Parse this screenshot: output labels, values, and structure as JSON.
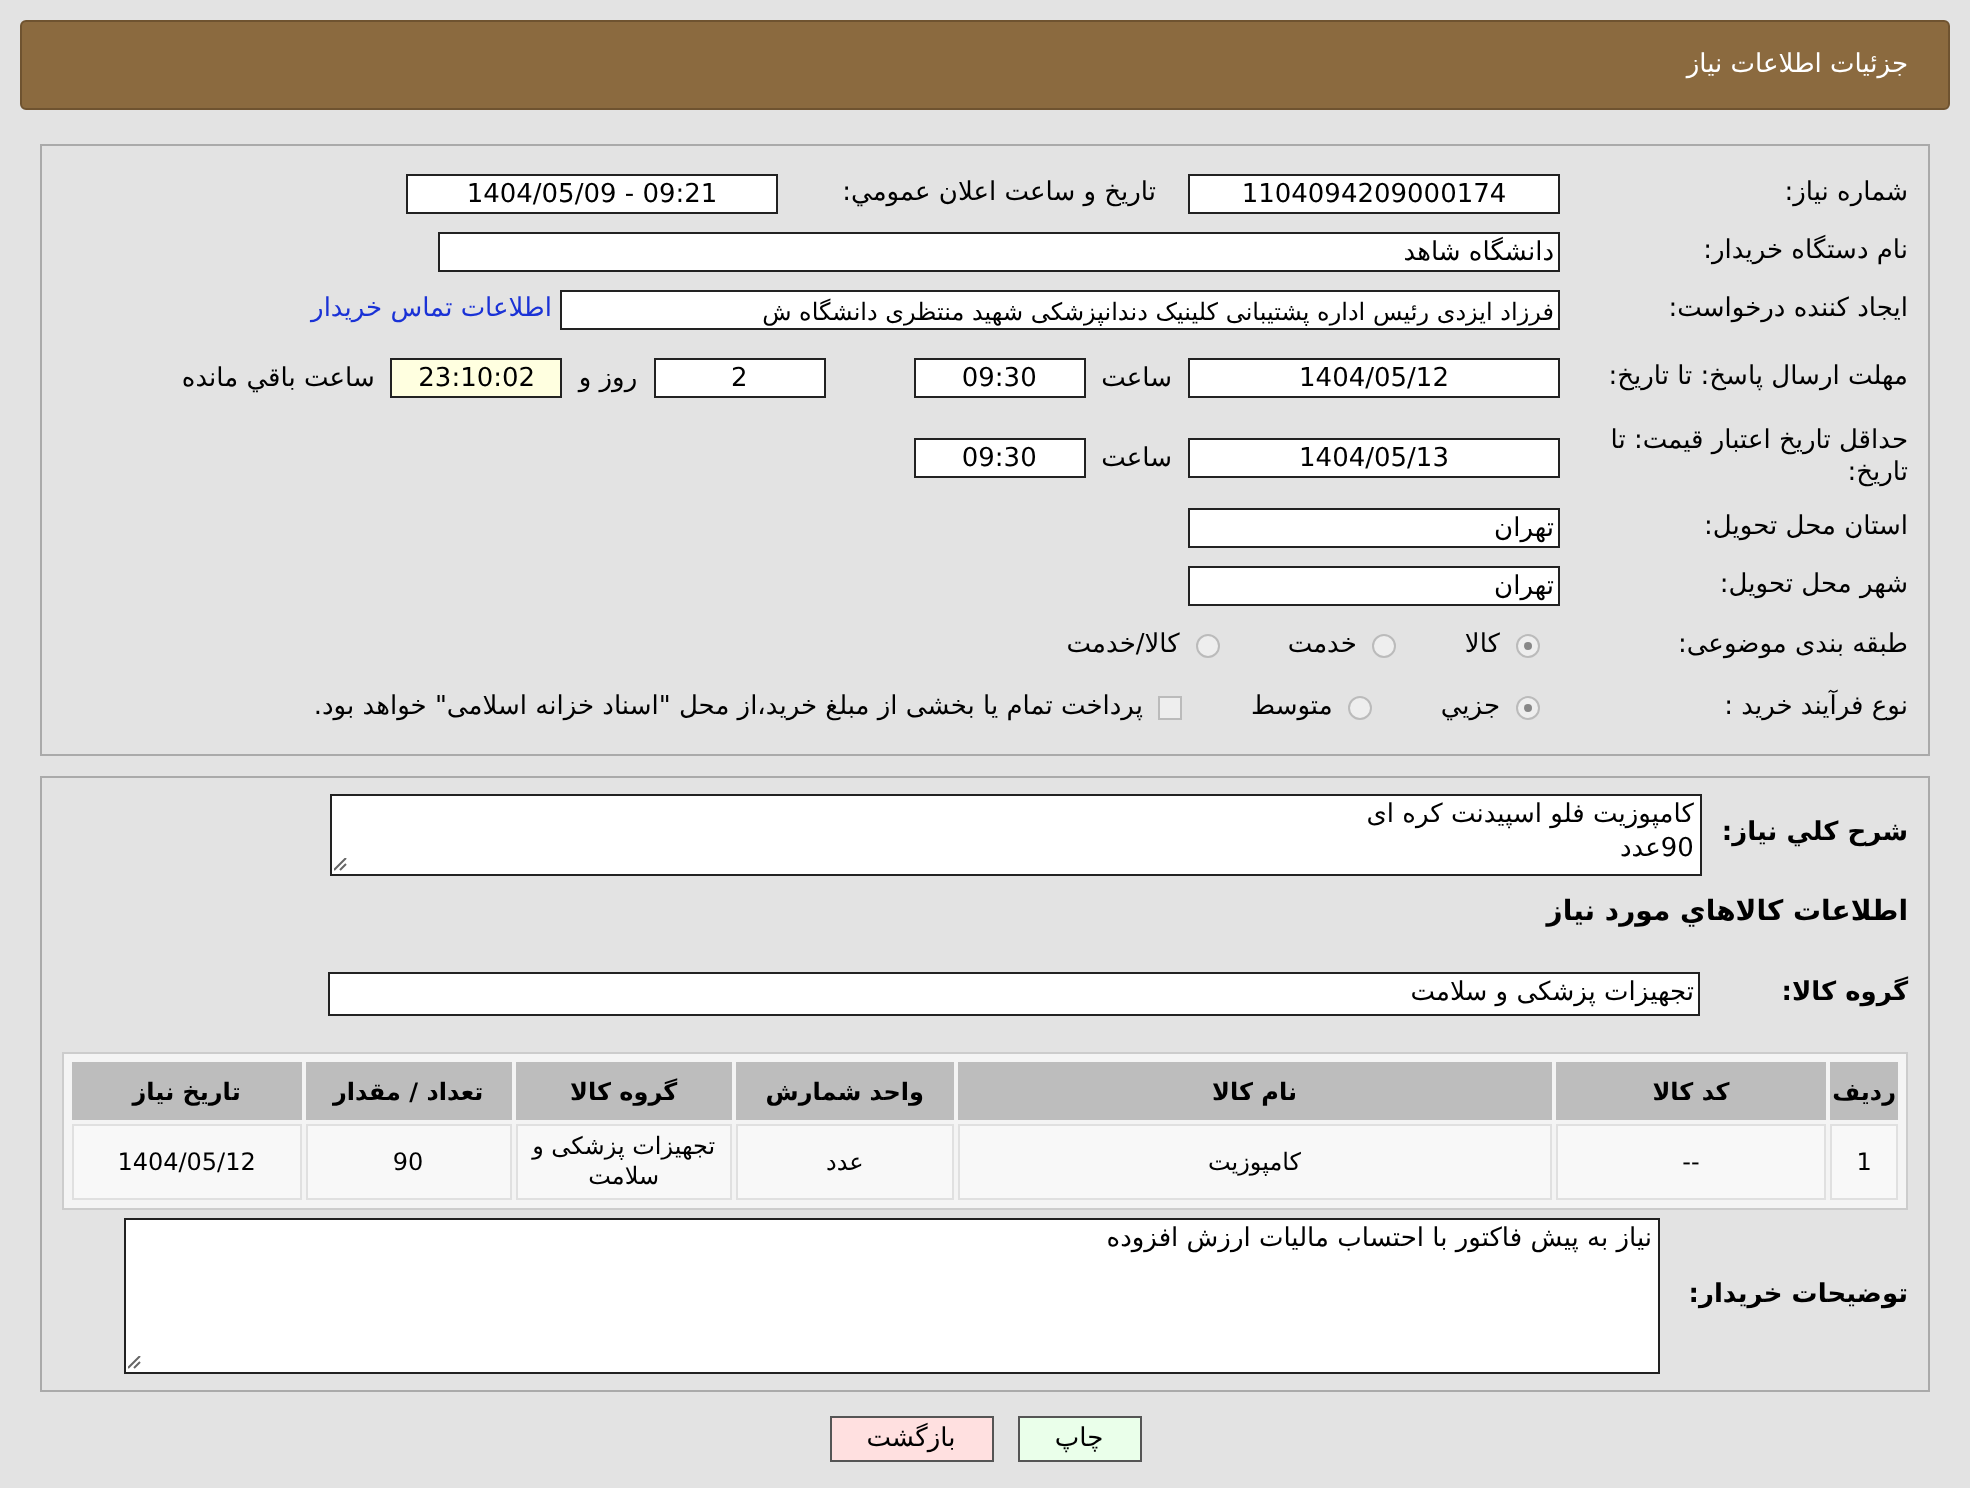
{
  "header": {
    "title": "جزئیات اطلاعات نیاز"
  },
  "need_number": {
    "label": "شماره نیاز:",
    "value": "1104094209000174"
  },
  "announce": {
    "label": "تاریخ و ساعت اعلان عمومي:",
    "value": "1404/05/09 - 09:21"
  },
  "buyer_org": {
    "label": "نام دستگاه خریدار:",
    "value": "دانشگاه شاهد"
  },
  "requester": {
    "label": "ایجاد کننده درخواست:",
    "value": "فرزاد ایزدی رئیس اداره پشتیبانی کلینیک دندانپزشکی شهید منتظری دانشگاه ش",
    "link": "اطلاعات تماس خریدار"
  },
  "reply_deadline": {
    "label": "مهلت ارسال پاسخ: تا تاریخ:",
    "date": "1404/05/12",
    "time_label": "ساعت",
    "time": "09:30",
    "days": "2",
    "days_label": "روز و",
    "remaining": "23:10:02",
    "remaining_label": "ساعت باقي مانده"
  },
  "price_validity": {
    "label": "حداقل تاریخ اعتبار قیمت: تا تاریخ:",
    "date": "1404/05/13",
    "time_label": "ساعت",
    "time": "09:30"
  },
  "province": {
    "label": "استان محل تحویل:",
    "value": "تهران"
  },
  "city": {
    "label": "شهر محل تحویل:",
    "value": "تهران"
  },
  "category": {
    "label": "طبقه بندی موضوعی:",
    "options": [
      {
        "kind": "radio",
        "label": "کالا",
        "selected": true
      },
      {
        "kind": "radio",
        "label": "خدمت",
        "selected": false
      },
      {
        "kind": "radio",
        "label": "کالا/خدمت",
        "selected": false
      }
    ]
  },
  "purchase_type": {
    "label": "نوع فرآیند خرید :",
    "options": [
      {
        "kind": "radio",
        "label": "جزيي",
        "selected": true
      },
      {
        "kind": "radio",
        "label": "متوسط",
        "selected": false
      },
      {
        "kind": "checkbox",
        "label": "پرداخت تمام یا بخشی از مبلغ خرید،از محل \"اسناد خزانه اسلامی\" خواهد بود.",
        "selected": false
      }
    ]
  },
  "description": {
    "label": "شرح کلي نياز:",
    "value": "کامپوزیت فلو اسپیدنت کره ای\n90عدد"
  },
  "items_heading": "اطلاعات کالاهاي مورد نياز",
  "goods_group": {
    "label": "گروه کالا:",
    "value": "تجهیزات پزشکی و سلامت"
  },
  "table": {
    "columns": [
      "ردیف",
      "کد کالا",
      "نام کالا",
      "واحد شمارش",
      "گروه کالا",
      "تعداد / مقدار",
      "تاریخ نیاز"
    ],
    "rows": [
      [
        "1",
        "--",
        "کامپوزیت",
        "عدد",
        "تجهیزات پزشکی و سلامت",
        "90",
        "1404/05/12"
      ]
    ]
  },
  "buyer_notes": {
    "label": "توضیحات خریدار:",
    "value": "نیاز به پیش فاکتور با احتساب مالیات ارزش افزوده"
  },
  "buttons": [
    {
      "kind": "print",
      "label": "چاپ"
    },
    {
      "kind": "back",
      "label": "بازگشت"
    }
  ]
}
